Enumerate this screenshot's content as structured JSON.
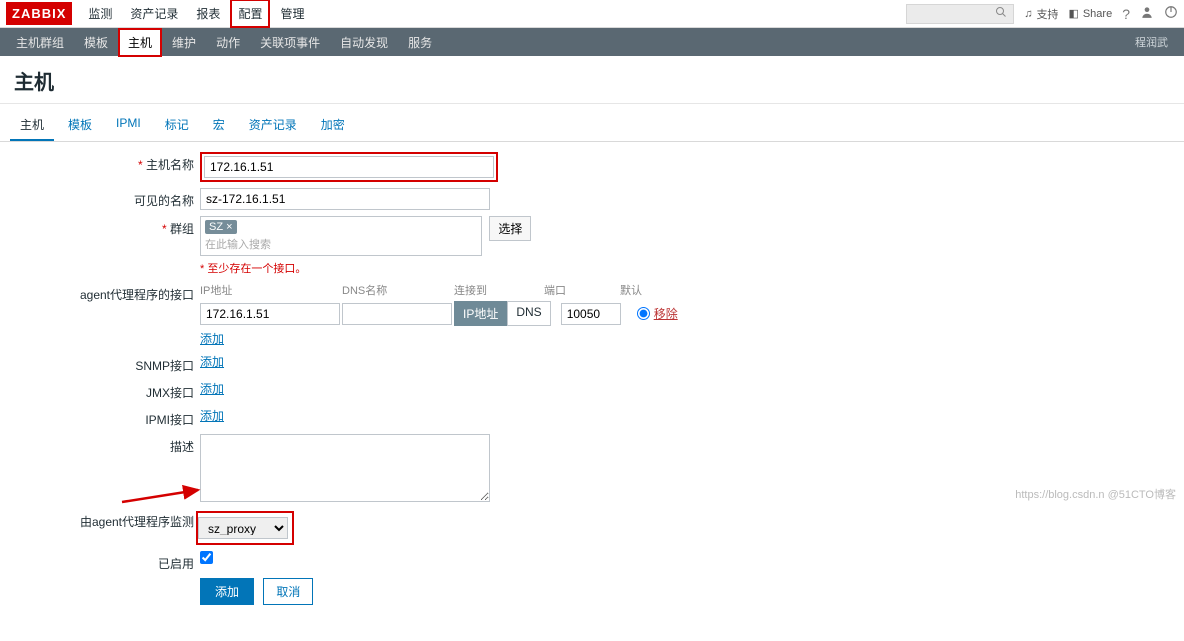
{
  "logo": "ZABBIX",
  "topnav": [
    "监测",
    "资产记录",
    "报表",
    "配置",
    "管理"
  ],
  "topnav_active": 3,
  "top_support": "支持",
  "top_share": "Share",
  "subnav": [
    "主机群组",
    "模板",
    "主机",
    "维护",
    "动作",
    "关联项事件",
    "自动发现",
    "服务"
  ],
  "subnav_active": 2,
  "subnav_right": "程润武",
  "page_title": "主机",
  "tabs": [
    "主机",
    "模板",
    "IPMI",
    "标记",
    "宏",
    "资产记录",
    "加密"
  ],
  "tabs_active": 0,
  "form": {
    "host_label": "主机名称",
    "host_value": "172.16.1.51",
    "visible_label": "可见的名称",
    "visible_value": "sz-172.16.1.51",
    "groups_label": "群组",
    "group_tag": "SZ",
    "groups_placeholder": "在此输入搜索",
    "select_btn": "选择",
    "iface_hint": "至少存在一个接口。",
    "agent_label": "agent代理程序的接口",
    "hdr_ip": "IP地址",
    "hdr_dns": "DNS名称",
    "hdr_conn": "连接到",
    "hdr_port": "端口",
    "hdr_def": "默认",
    "ip_value": "172.16.1.51",
    "dns_value": "",
    "seg_ip": "IP地址",
    "seg_dns": "DNS",
    "port_value": "10050",
    "remove": "移除",
    "add_link": "添加",
    "snmp_label": "SNMP接口",
    "jmx_label": "JMX接口",
    "ipmi_label": "IPMI接口",
    "desc_label": "描述",
    "proxy_label": "由agent代理程序监测",
    "proxy_value": "sz_proxy",
    "enabled_label": "已启用",
    "btn_add": "添加",
    "btn_cancel": "取消"
  },
  "watermark": "https://blog.csdn.n @51CTO博客"
}
